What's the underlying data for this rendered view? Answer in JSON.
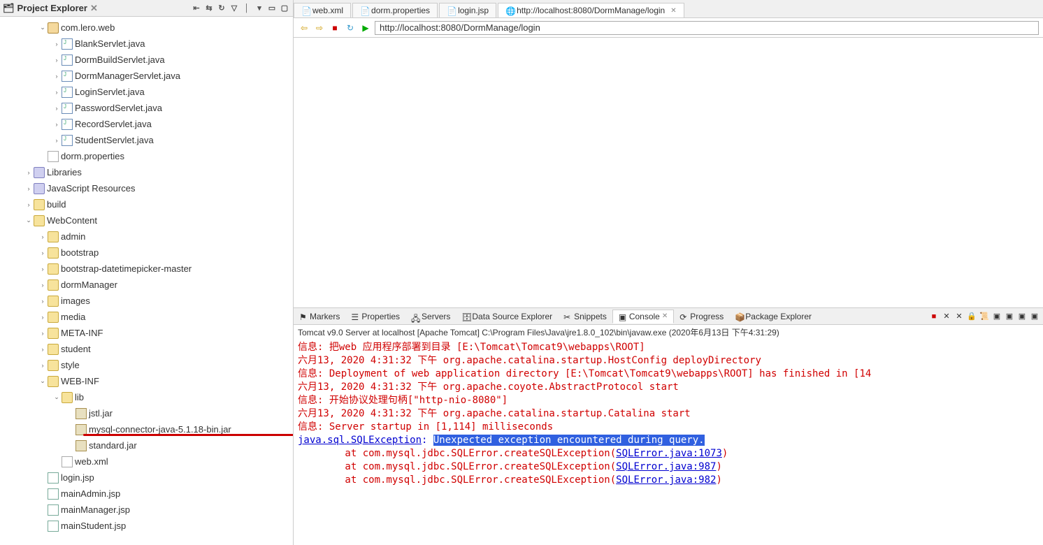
{
  "explorer": {
    "title": "Project Explorer",
    "toolbar_icons": [
      "collapse",
      "link",
      "refresh",
      "filter",
      "sep",
      "menu",
      "sep",
      "min",
      "max"
    ],
    "tree": [
      {
        "indent": 1,
        "twist": "v",
        "icon": "pkg",
        "label": "com.lero.web"
      },
      {
        "indent": 2,
        "twist": ">",
        "icon": "java",
        "label": "BlankServlet.java"
      },
      {
        "indent": 2,
        "twist": ">",
        "icon": "java",
        "label": "DormBuildServlet.java"
      },
      {
        "indent": 2,
        "twist": ">",
        "icon": "java",
        "label": "DormManagerServlet.java"
      },
      {
        "indent": 2,
        "twist": ">",
        "icon": "java",
        "label": "LoginServlet.java"
      },
      {
        "indent": 2,
        "twist": ">",
        "icon": "java",
        "label": "PasswordServlet.java"
      },
      {
        "indent": 2,
        "twist": ">",
        "icon": "java",
        "label": "RecordServlet.java"
      },
      {
        "indent": 2,
        "twist": ">",
        "icon": "java",
        "label": "StudentServlet.java"
      },
      {
        "indent": 1,
        "twist": "",
        "icon": "file",
        "label": "dorm.properties"
      },
      {
        "indent": 0,
        "twist": ">",
        "icon": "lib",
        "label": "Libraries"
      },
      {
        "indent": 0,
        "twist": ">",
        "icon": "lib",
        "label": "JavaScript Resources"
      },
      {
        "indent": 0,
        "twist": ">",
        "icon": "folder",
        "label": "build"
      },
      {
        "indent": 0,
        "twist": "v",
        "icon": "folder-open",
        "label": "WebContent"
      },
      {
        "indent": 1,
        "twist": ">",
        "icon": "folder-open",
        "label": "admin"
      },
      {
        "indent": 1,
        "twist": ">",
        "icon": "folder-open",
        "label": "bootstrap"
      },
      {
        "indent": 1,
        "twist": ">",
        "icon": "folder-open",
        "label": "bootstrap-datetimepicker-master"
      },
      {
        "indent": 1,
        "twist": ">",
        "icon": "folder-open",
        "label": "dormManager"
      },
      {
        "indent": 1,
        "twist": ">",
        "icon": "folder-open",
        "label": "images"
      },
      {
        "indent": 1,
        "twist": ">",
        "icon": "folder-open",
        "label": "media"
      },
      {
        "indent": 1,
        "twist": ">",
        "icon": "folder-open",
        "label": "META-INF"
      },
      {
        "indent": 1,
        "twist": ">",
        "icon": "folder-open",
        "label": "student"
      },
      {
        "indent": 1,
        "twist": ">",
        "icon": "folder-open",
        "label": "style"
      },
      {
        "indent": 1,
        "twist": "v",
        "icon": "folder-open",
        "label": "WEB-INF"
      },
      {
        "indent": 2,
        "twist": "v",
        "icon": "folder-open",
        "label": "lib"
      },
      {
        "indent": 3,
        "twist": "",
        "icon": "jar",
        "label": "jstl.jar"
      },
      {
        "indent": 3,
        "twist": "",
        "icon": "jar",
        "label": "mysql-connector-java-5.1.18-bin.jar",
        "marked": true
      },
      {
        "indent": 3,
        "twist": "",
        "icon": "jar",
        "label": "standard.jar"
      },
      {
        "indent": 2,
        "twist": "",
        "icon": "file",
        "label": "web.xml"
      },
      {
        "indent": 1,
        "twist": "",
        "icon": "jsp",
        "label": "login.jsp"
      },
      {
        "indent": 1,
        "twist": "",
        "icon": "jsp",
        "label": "mainAdmin.jsp"
      },
      {
        "indent": 1,
        "twist": "",
        "icon": "jsp",
        "label": "mainManager.jsp"
      },
      {
        "indent": 1,
        "twist": "",
        "icon": "jsp",
        "label": "mainStudent.jsp"
      }
    ]
  },
  "editor_tabs": [
    {
      "icon": "file",
      "label": "web.xml",
      "active": false
    },
    {
      "icon": "file",
      "label": "dorm.properties",
      "active": false
    },
    {
      "icon": "jsp",
      "label": "login.jsp",
      "active": false
    },
    {
      "icon": "globe",
      "label": "http://localhost:8080/DormManage/login",
      "active": true
    }
  ],
  "browser": {
    "url": "http://localhost:8080/DormManage/login"
  },
  "bottom_tabs": [
    {
      "label": "Markers",
      "icon": "marker"
    },
    {
      "label": "Properties",
      "icon": "props"
    },
    {
      "label": "Servers",
      "icon": "server"
    },
    {
      "label": "Data Source Explorer",
      "icon": "db"
    },
    {
      "label": "Snippets",
      "icon": "snip"
    },
    {
      "label": "Console",
      "icon": "console",
      "active": true
    },
    {
      "label": "Progress",
      "icon": "prog"
    },
    {
      "label": "Package Explorer",
      "icon": "pkg"
    }
  ],
  "console": {
    "head": "Tomcat v9.0 Server at localhost [Apache Tomcat] C:\\Program Files\\Java\\jre1.8.0_102\\bin\\javaw.exe (2020年6月13日 下午4:31:29)",
    "lines": [
      {
        "type": "red",
        "text": "信息: 把web 应用程序部署到目录 [E:\\Tomcat\\Tomcat9\\webapps\\ROOT]"
      },
      {
        "type": "red",
        "text": "六月13, 2020 4:31:32 下午 org.apache.catalina.startup.HostConfig deployDirectory"
      },
      {
        "type": "red",
        "text": "信息: Deployment of web application directory [E:\\Tomcat\\Tomcat9\\webapps\\ROOT] has finished in [14"
      },
      {
        "type": "red",
        "text": "六月13, 2020 4:31:32 下午 org.apache.coyote.AbstractProtocol start"
      },
      {
        "type": "red",
        "text": "信息: 开始协议处理句柄[\"http-nio-8080\"]"
      },
      {
        "type": "red",
        "text": "六月13, 2020 4:31:32 下午 org.apache.catalina.startup.Catalina start"
      },
      {
        "type": "red",
        "text": "信息: Server startup in [1,114] milliseconds"
      },
      {
        "type": "exc",
        "prefix": "java.sql.SQLException",
        "hl": "Unexpected exception encountered during query."
      },
      {
        "type": "stack",
        "text": "        at com.mysql.jdbc.SQLError.createSQLException(",
        "link": "SQLError.java:1073",
        "tail": ")"
      },
      {
        "type": "stack",
        "text": "        at com.mysql.jdbc.SQLError.createSQLException(",
        "link": "SQLError.java:987",
        "tail": ")"
      },
      {
        "type": "stack",
        "text": "        at com.mysql.jdbc.SQLError.createSQLException(",
        "link": "SQLError.java:982",
        "tail": ")"
      }
    ]
  }
}
